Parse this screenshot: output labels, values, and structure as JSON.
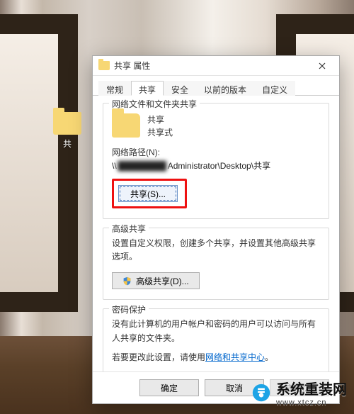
{
  "desktop": {
    "folder_label": "共"
  },
  "dialog": {
    "title": "共享 属性",
    "tabs": [
      "常规",
      "共享",
      "安全",
      "以前的版本",
      "自定义"
    ],
    "active_tab_index": 1,
    "section_share": {
      "legend": "网络文件和文件夹共享",
      "name": "共享",
      "state": "共享式",
      "path_label": "网络路径(N):",
      "path_prefix": "\\\\",
      "path_blur": "████████",
      "path_suffix": "Administrator\\Desktop\\共享",
      "share_button": "共享(S)..."
    },
    "section_adv": {
      "legend": "高级共享",
      "desc": "设置自定义权限，创建多个共享，并设置其他高级共享选项。",
      "button": "高级共享(D)..."
    },
    "section_pwd": {
      "legend": "密码保护",
      "line1": "没有此计算机的用户帐户和密码的用户可以访问与所有人共享的文件夹。",
      "line2_prefix": "若要更改此设置，请使用",
      "link": "网络和共享中心",
      "line2_suffix": "。"
    },
    "footer": {
      "ok": "确定",
      "cancel": "取消",
      "apply": "应用(A)"
    }
  },
  "watermark": {
    "text": "系统重装网",
    "sub": "www.xtcz.cn"
  }
}
